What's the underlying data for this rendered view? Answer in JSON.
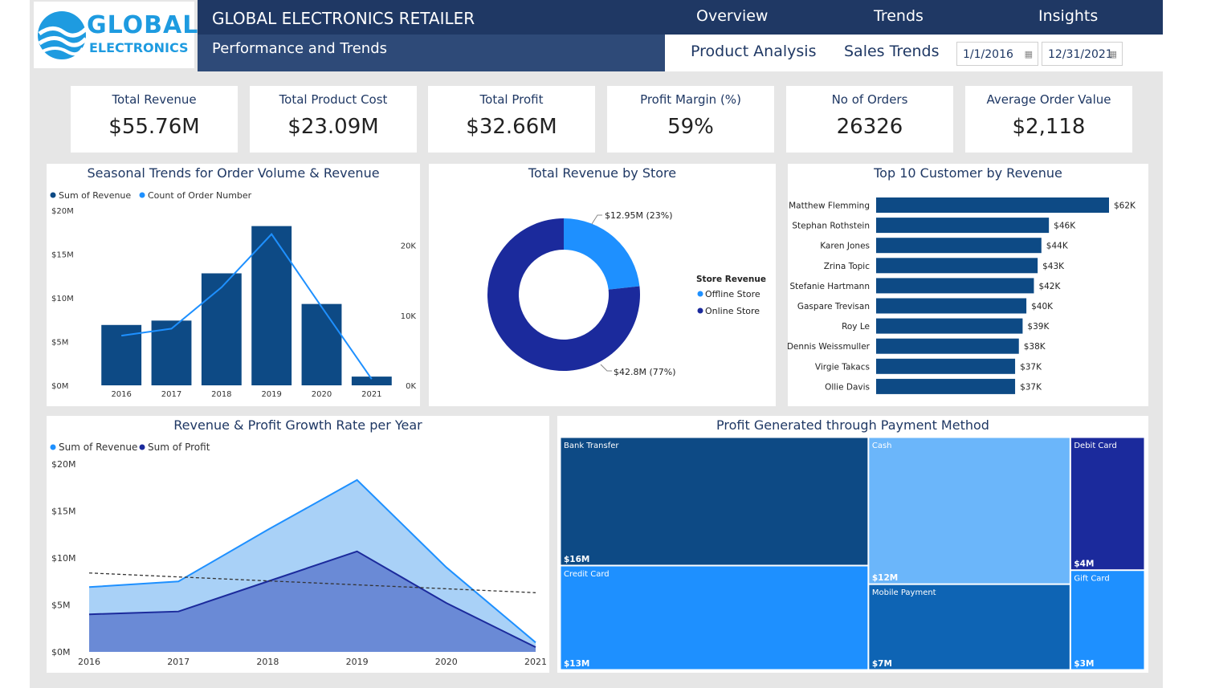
{
  "header": {
    "logo_line1": "GLOBAL",
    "logo_line2": "ELECTRONICS",
    "title": "GLOBAL ELECTRONICS RETAILER",
    "subtitle": "Performance and Trends",
    "nav": [
      "Overview",
      "Trends",
      "Insights"
    ],
    "subnav": [
      "Product Analysis",
      "Sales Trends"
    ],
    "date_start": "1/1/2016",
    "date_end": "12/31/2021"
  },
  "kpis": [
    {
      "label": "Total Revenue",
      "value": "$55.76M"
    },
    {
      "label": "Total Product Cost",
      "value": "$23.09M"
    },
    {
      "label": "Total Profit",
      "value": "$32.66M"
    },
    {
      "label": "Profit Margin (%)",
      "value": "59%"
    },
    {
      "label": "No of Orders",
      "value": "26326"
    },
    {
      "label": "Average Order Value",
      "value": "$2,118"
    }
  ],
  "colors": {
    "navy": "#1f3864",
    "bar_blue": "#0d4a85",
    "light_blue": "#1e90ff",
    "sky": "#a9d1f7",
    "indigo": "#1b2a9c"
  },
  "chart_data": [
    {
      "id": "seasonal",
      "type": "bar",
      "title": "Seasonal Trends for Order Volume & Revenue",
      "legend": [
        "Sum of Revenue",
        "Count of Order Number"
      ],
      "categories": [
        "2016",
        "2017",
        "2018",
        "2019",
        "2020",
        "2021"
      ],
      "series": [
        {
          "name": "Sum of Revenue",
          "axis": "left",
          "values": [
            6.9,
            7.4,
            12.8,
            18.2,
            9.3,
            1.0
          ]
        },
        {
          "name": "Count of Order Number",
          "axis": "right",
          "type": "line",
          "values": [
            7100,
            8100,
            14000,
            21600,
            11200,
            900
          ]
        }
      ],
      "y_left_ticks": [
        "$0M",
        "$5M",
        "$10M",
        "$15M",
        "$20M"
      ],
      "y_left_lim": [
        0,
        20
      ],
      "y_right_ticks": [
        "0K",
        "10K",
        "20K"
      ],
      "y_right_lim": [
        0,
        25000
      ]
    },
    {
      "id": "store",
      "type": "pie",
      "title": "Total Revenue by Store",
      "legend_title": "Store Revenue",
      "slices": [
        {
          "name": "Offline Store",
          "value": 12.95,
          "label": "$12.95M (23%)"
        },
        {
          "name": "Online Store",
          "value": 42.8,
          "label": "$42.8M (77%)"
        }
      ]
    },
    {
      "id": "customers",
      "type": "bar",
      "orientation": "horizontal",
      "title": "Top 10 Customer by Revenue",
      "categories": [
        "Matthew Flemming",
        "Stephan Rothstein",
        "Karen Jones",
        "Zrina Topic",
        "Stefanie Hartmann",
        "Gaspare Trevisan",
        "Roy Le",
        "Dennis Weissmuller",
        "Virgie Takacs",
        "Ollie Davis"
      ],
      "values": [
        62,
        46,
        44,
        43,
        42,
        40,
        39,
        38,
        37,
        37
      ],
      "labels": [
        "$62K",
        "$46K",
        "$44K",
        "$43K",
        "$42K",
        "$40K",
        "$39K",
        "$38K",
        "$37K",
        "$37K"
      ]
    },
    {
      "id": "growth",
      "type": "area",
      "title": "Revenue & Profit Growth Rate per Year",
      "legend": [
        "Sum of Revenue",
        "Sum of Profit"
      ],
      "x": [
        "2016",
        "2017",
        "2018",
        "2019",
        "2020",
        "2021"
      ],
      "series": [
        {
          "name": "Sum of Revenue",
          "values": [
            6.9,
            7.5,
            13.0,
            18.3,
            9.0,
            1.0
          ]
        },
        {
          "name": "Sum of Profit",
          "values": [
            4.0,
            4.3,
            7.5,
            10.7,
            5.2,
            0.5
          ]
        }
      ],
      "trend": [
        8.4,
        6.3
      ],
      "y_ticks": [
        "$0M",
        "$5M",
        "$10M",
        "$15M",
        "$20M"
      ],
      "ylim": [
        0,
        20
      ]
    },
    {
      "id": "payment",
      "type": "treemap",
      "title": "Profit Generated through Payment Method",
      "items": [
        {
          "name": "Bank Transfer",
          "value": 16,
          "label": "$16M"
        },
        {
          "name": "Credit Card",
          "value": 13,
          "label": "$13M"
        },
        {
          "name": "Cash",
          "value": 12,
          "label": "$12M"
        },
        {
          "name": "Mobile Payment",
          "value": 7,
          "label": "$7M"
        },
        {
          "name": "Debit Card",
          "value": 4,
          "label": "$4M"
        },
        {
          "name": "Gift Card",
          "value": 3,
          "label": "$3M"
        }
      ]
    }
  ]
}
